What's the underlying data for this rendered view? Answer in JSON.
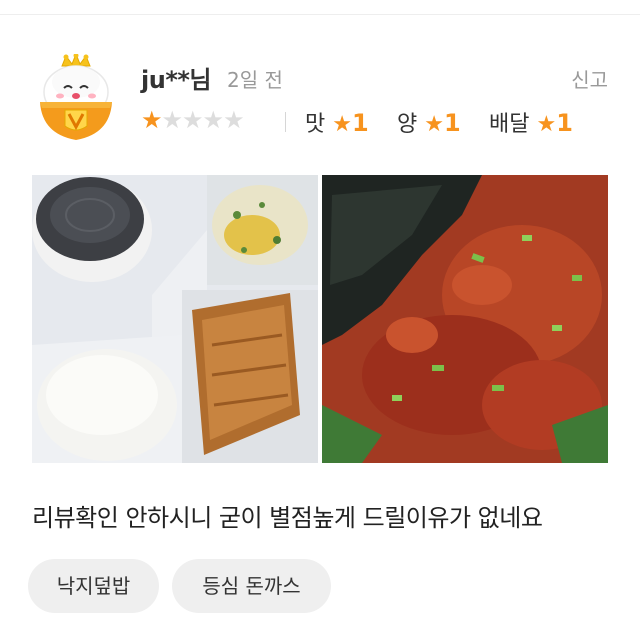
{
  "review": {
    "username": "ju**님",
    "date": "2일 전",
    "report_label": "신고",
    "rating_overall": 1,
    "rating_max": 5,
    "sub_ratings": [
      {
        "label": "맛",
        "value": "1"
      },
      {
        "label": "양",
        "value": "1"
      },
      {
        "label": "배달",
        "value": "1"
      }
    ],
    "photos": [
      {
        "icon": "bento-photo"
      },
      {
        "icon": "spicy-octopus-photo"
      }
    ],
    "text": "리뷰확인 안하시니 굳이 별점높게 드릴이유가 없네요",
    "menu_tags": [
      "낙지덮밥",
      "등심 돈까스"
    ]
  },
  "colors": {
    "accent": "#f7931e",
    "star_empty": "#dddddd",
    "tag_bg": "#efefef",
    "muted_text": "#999999"
  },
  "avatar_icon": "crowned-rice-bowl-v-icon"
}
